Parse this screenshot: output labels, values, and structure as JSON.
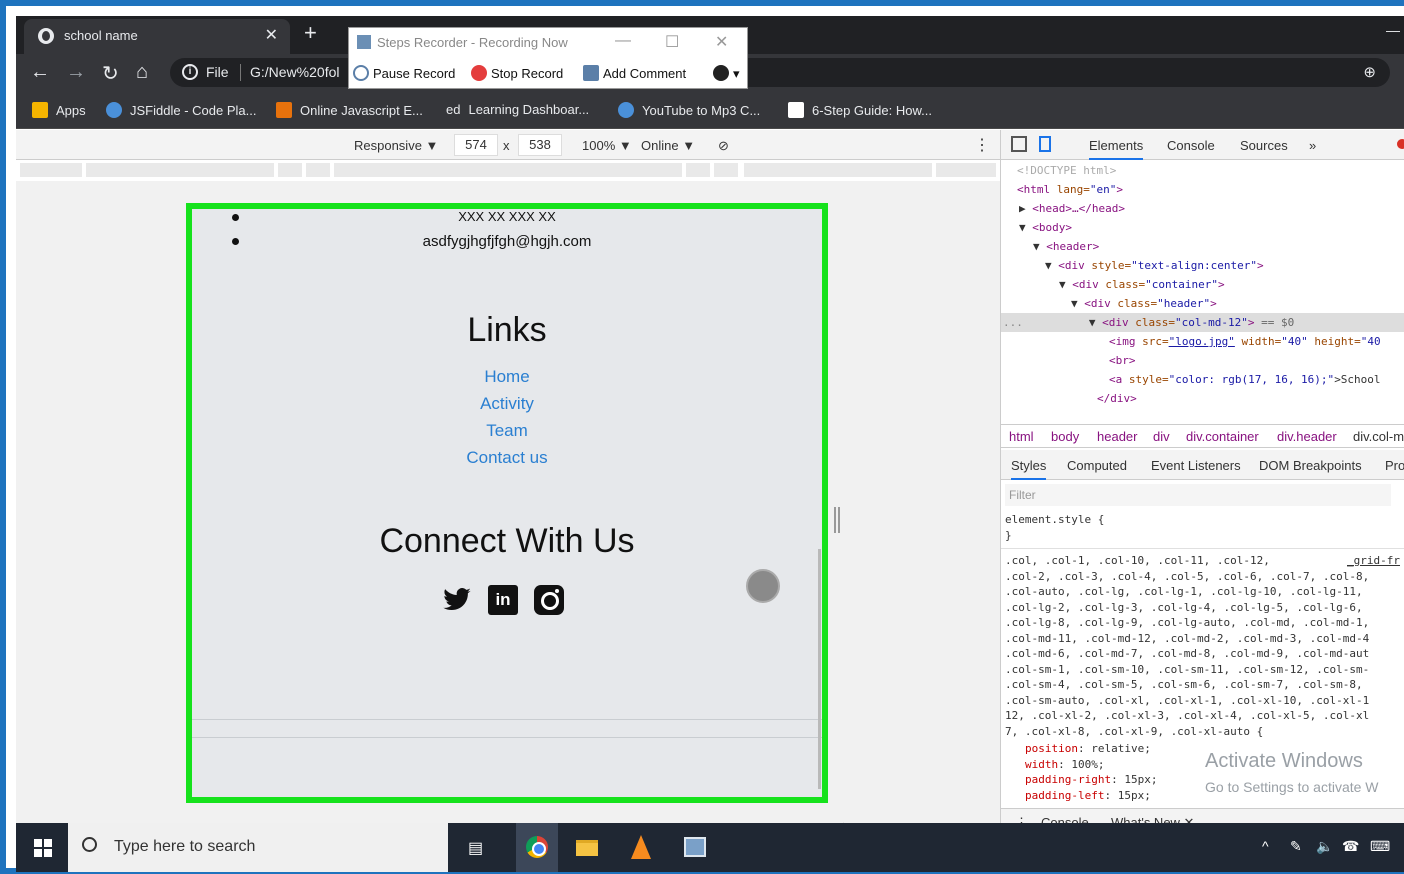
{
  "browser": {
    "tab_title": "school name",
    "tab_close": "✕",
    "new_tab": "+",
    "file_label": "File",
    "url": "G:/New%20fol",
    "bookmarks": [
      {
        "label": "Apps",
        "color": "#f4b400"
      },
      {
        "label": "JSFiddle - Code Pla...",
        "color": "#4a90d9"
      },
      {
        "label": "Online Javascript E...",
        "color": "#e8720c"
      },
      {
        "label": "Learning Dashboar...",
        "color": "#35363a"
      },
      {
        "label": "YouTube to Mp3 C...",
        "color": "#4a90d9"
      },
      {
        "label": "6-Step Guide: How...",
        "color": "#ffffff"
      }
    ],
    "bookmark_ed": "ed"
  },
  "recorder": {
    "title": "Steps Recorder - Recording Now",
    "pause": "Pause Record",
    "stop": "Stop Record",
    "comment": "Add Comment"
  },
  "device_toolbar": {
    "mode": "Responsive ▼",
    "width": "574",
    "times": "x",
    "height": "538",
    "zoom": "100% ▼",
    "network": "Online ▼"
  },
  "site": {
    "phone": "XXX XX XXX XX",
    "email": "asdfygjhgfjfgh@hgjh.com",
    "links_title": "Links",
    "links": [
      "Home",
      "Activity",
      "Team",
      "Contact us"
    ],
    "connect_title": "Connect With Us",
    "linkedin_text": "in"
  },
  "devtools": {
    "tabs": [
      "Elements",
      "Console",
      "Sources",
      "»"
    ],
    "dom": {
      "doctype": "<!DOCTYPE html>",
      "html_open": "<html",
      "lang_attr": " lang=",
      "lang_val": "\"en\"",
      "html_close": ">",
      "head": "<head>…</head>",
      "body": "<body>",
      "header": "<header>",
      "div_open": "<div",
      "style_attr": " style=",
      "style_val": "\"text-align:center\"",
      "class_attr": " class=",
      "container_val": "\"container\"",
      "header_val": "\"header\"",
      "col_val": "\"col-md-12\"",
      "tag_end": ">",
      "selected_suffix": " == $0",
      "img_open": "<img",
      "src_attr": " src=",
      "src_val": "\"logo.jpg\"",
      "width_attr": " width=",
      "width_val": "\"40\"",
      "height_attr": " height=",
      "height_val": "\"40",
      "br": "<br>",
      "a_open": "<a",
      "a_style_val": "\"color: rgb(17, 16, 16);\"",
      "a_text": ">School",
      "div_close": "</div>",
      "arrow_right": "▶",
      "arrow_down": "▼",
      "dots": "..."
    },
    "breadcrumbs": [
      "html",
      "body",
      "header",
      "div",
      "div.container",
      "div.header",
      "div.col-m"
    ],
    "subtabs": [
      "Styles",
      "Computed",
      "Event Listeners",
      "DOM Breakpoints",
      "Pro"
    ],
    "filter_placeholder": "Filter",
    "styles": {
      "element_style": "element.style {",
      "close_brace": "}",
      "grid_link": "_grid-fr",
      "selector_lines": [
        ".col, .col-1, .col-10, .col-11, .col-12,",
        ".col-2, .col-3, .col-4, .col-5, .col-6, .col-7, .col-8,",
        ".col-auto, .col-lg, .col-lg-1, .col-lg-10, .col-lg-11,",
        ".col-lg-2, .col-lg-3, .col-lg-4, .col-lg-5, .col-lg-6,",
        ".col-lg-8, .col-lg-9, .col-lg-auto, .col-md, .col-md-1,",
        ".col-md-11, .col-md-12, .col-md-2, .col-md-3, .col-md-4",
        ".col-md-6, .col-md-7, .col-md-8, .col-md-9, .col-md-aut",
        ".col-sm-1, .col-sm-10, .col-sm-11, .col-sm-12, .col-sm-",
        ".col-sm-4, .col-sm-5, .col-sm-6, .col-sm-7, .col-sm-8,",
        ".col-sm-auto, .col-xl, .col-xl-1, .col-xl-10, .col-xl-1",
        "12, .col-xl-2, .col-xl-3, .col-xl-4, .col-xl-5, .col-xl",
        "7, .col-xl-8, .col-xl-9, .col-xl-auto {"
      ],
      "props": [
        {
          "name": "position",
          "value": " relative;"
        },
        {
          "name": "width",
          "value": " 100%;"
        },
        {
          "name": "padding-right",
          "value": " 15px;"
        },
        {
          "name": "padding-left",
          "value": " 15px;"
        }
      ]
    },
    "watermark_title": "Activate Windows",
    "watermark_sub": "Go to Settings to activate W",
    "drawer": {
      "console": "Console",
      "whats_new": "What's New ✕"
    }
  },
  "taskbar": {
    "search_placeholder": "Type here to search"
  },
  "colors": {
    "frame": "#1e73be",
    "device_border": "#16e21c",
    "link": "#2a7fd1"
  }
}
